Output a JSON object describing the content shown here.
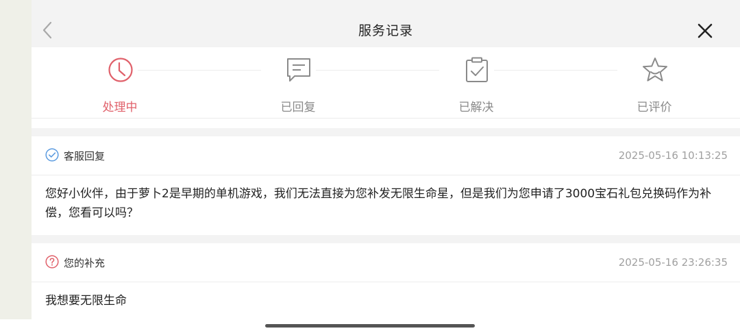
{
  "header": {
    "title": "服务记录"
  },
  "steps": [
    {
      "label": "处理中",
      "icon": "clock-icon",
      "active": true
    },
    {
      "label": "已回复",
      "icon": "message-icon",
      "active": false
    },
    {
      "label": "已解决",
      "icon": "clipboard-check-icon",
      "active": false
    },
    {
      "label": "已评价",
      "icon": "star-icon",
      "active": false
    }
  ],
  "records": [
    {
      "type": "客服回复",
      "icon": "check-circle-icon",
      "time": "2025-05-16 10:13:25",
      "content": "您好小伙伴，由于萝卜2是早期的单机游戏，我们无法直接为您补发无限生命星，但是我们为您申请了3000宝石礼包兑换码作为补偿，您看可以吗？"
    },
    {
      "type": "您的补充",
      "icon": "question-circle-icon",
      "time": "2025-05-16 23:26:35",
      "content": "我想要无限生命"
    }
  ],
  "colors": {
    "accent": "#e0606a",
    "reply_icon": "#5b9be0",
    "inactive": "#8a8a8a",
    "time": "#a0a0a0",
    "sidebar_bg": "#eff0e8",
    "header_bg": "#f3f3f3"
  }
}
